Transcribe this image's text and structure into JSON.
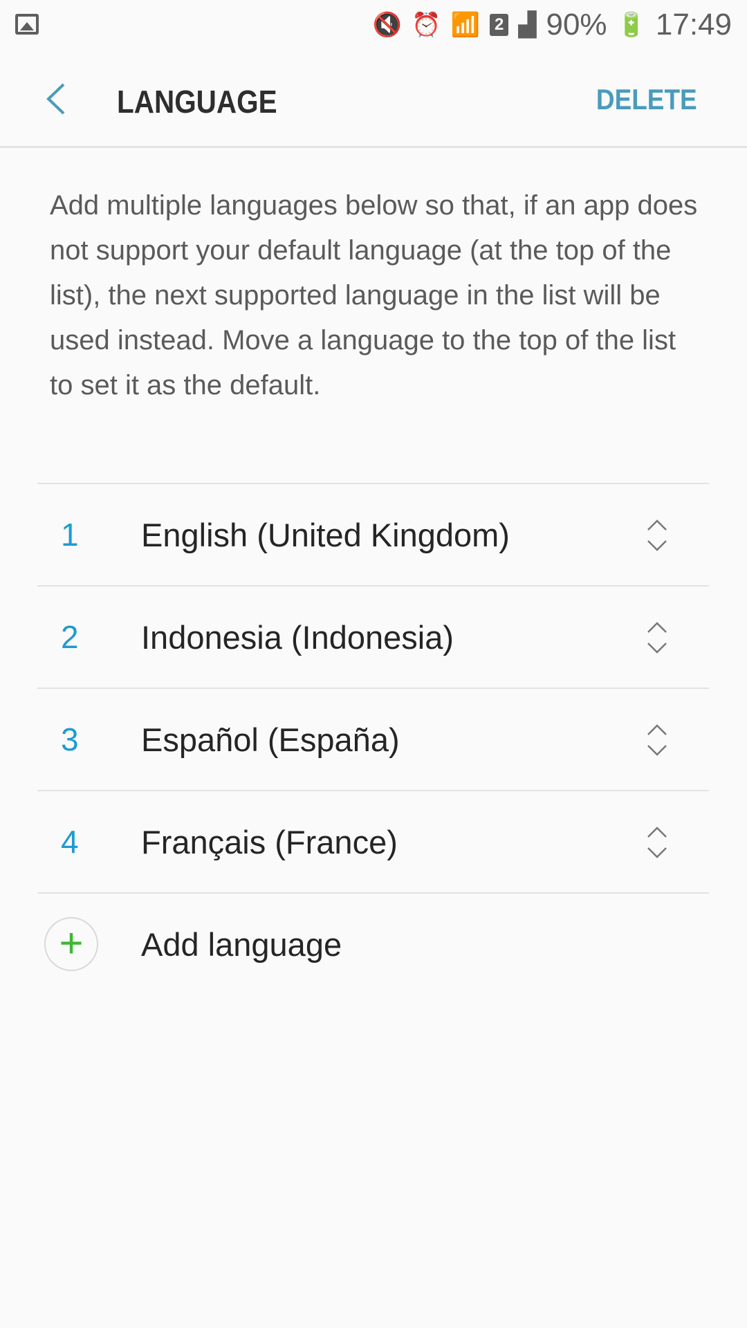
{
  "status_bar": {
    "battery": "90%",
    "time": "17:49",
    "sim_badge": "2"
  },
  "header": {
    "title": "LANGUAGE",
    "delete_label": "DELETE"
  },
  "description": "Add multiple languages below so that, if an app does not support your default language (at the top of the list), the next supported language in the list will be used instead. Move a language to the top of the list to set it as the default.",
  "languages": [
    {
      "num": "1",
      "name": "English (United Kingdom)"
    },
    {
      "num": "2",
      "name": "Indonesia (Indonesia)"
    },
    {
      "num": "3",
      "name": "Español (España)"
    },
    {
      "num": "4",
      "name": "Français (France)"
    }
  ],
  "add_label": "Add language",
  "colors": {
    "accent": "#4a9bbb",
    "number": "#1d9bd1",
    "plus": "#3cb832"
  }
}
